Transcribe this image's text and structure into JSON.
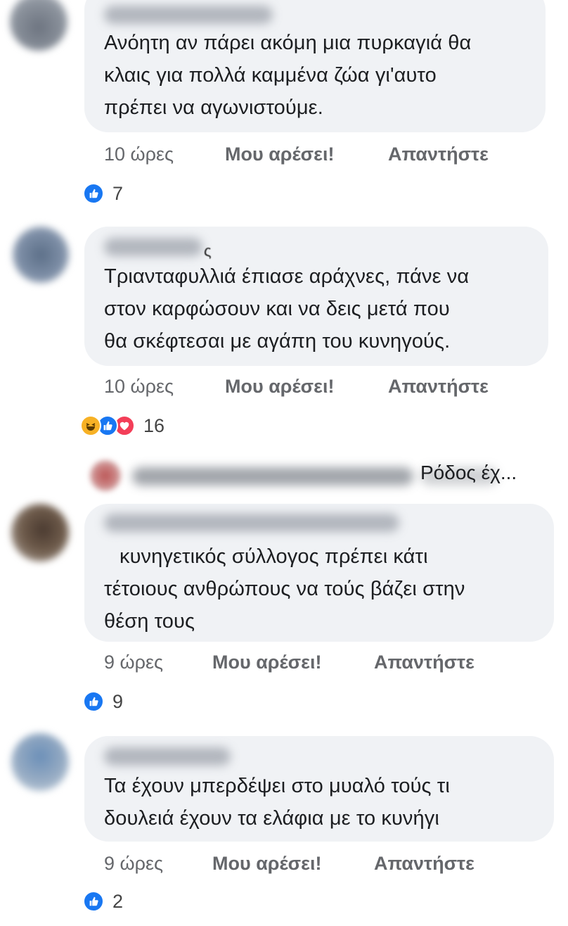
{
  "comments": [
    {
      "lines": [
        "Ανόητη αν πάρει ακόμη μια πυρκαγιά θα",
        "κλαις για πολλά καμμένα ζώα γι'αυτο",
        "πρέπει να αγωνιστούμε."
      ],
      "author_visible": "",
      "time": "10 ώρες",
      "like_label": "Μου αρέσει!",
      "reply_label": "Απαντήστε",
      "reaction_icons": [
        "like-icon"
      ],
      "reaction_count": "7"
    },
    {
      "lines": [
        "Τριανταφυλλιά έπιασε αράχνες, πάνε να",
        "στον καρφώσουν και να δεις μετά που",
        "θα σκέφτεσαι με αγάπη του κυνηγούς."
      ],
      "author_visible": "ς",
      "time": "10 ώρες",
      "like_label": "Μου αρέσει!",
      "reply_label": "Απαντήστε",
      "reaction_icons": [
        "haha-icon",
        "like-icon",
        "love-icon"
      ],
      "reaction_count": "16"
    },
    {
      "lines": [
        "κυνηγετικός σύλλογος πρέπει κάτι",
        "τέτοιους ανθρώπους να τούς βάζει στην",
        "θέση τους"
      ],
      "author_visible": "",
      "time": "9 ώρες",
      "like_label": "Μου αρέσει!",
      "reply_label": "Απαντήστε",
      "reaction_icons": [
        "like-icon"
      ],
      "reaction_count": "9"
    },
    {
      "lines": [
        "Τα έχουν  μπερδέψει  στο μυαλό τούς  τι",
        "δουλειά  έχουν τα ελάφια  με το κυνήγι"
      ],
      "author_visible": "",
      "time": "9 ώρες",
      "like_label": "Μου αρέσει!",
      "reply_label": "Απαντήστε",
      "reaction_icons": [
        "like-icon"
      ],
      "reaction_count": "2"
    }
  ],
  "reply_preview": {
    "text": "Ρόδος έχ..."
  },
  "colors": {
    "bubble": "#f0f2f5",
    "like_blue": "#1877f2",
    "love_red": "#f33e58",
    "haha_yellow": "#f7b125",
    "meta_grey": "#65676b"
  }
}
